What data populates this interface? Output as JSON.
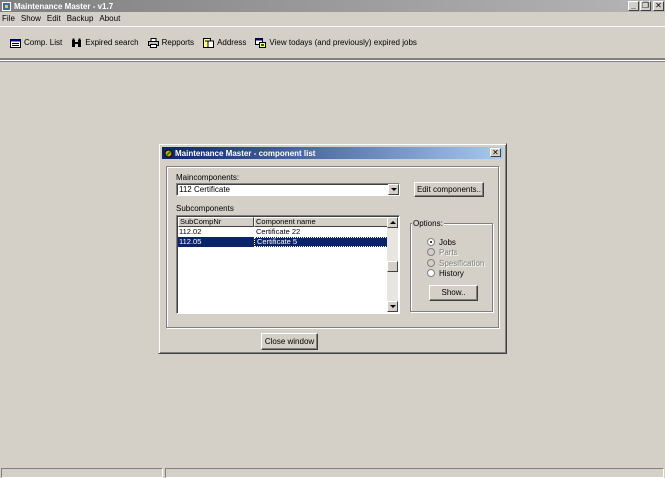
{
  "app": {
    "title": "Maintenance Master - v1.7",
    "window_buttons": {
      "minimize": "_",
      "restore": "❐",
      "close": "✕"
    }
  },
  "menu": [
    "File",
    "Show",
    "Edit",
    "Backup",
    "About"
  ],
  "toolbar": {
    "items": [
      {
        "label": "Comp. List",
        "icon": "list-icon"
      },
      {
        "label": "Expired search",
        "icon": "binoculars-icon"
      },
      {
        "label": "Repports",
        "icon": "printer-icon"
      },
      {
        "label": "Address",
        "icon": "address-icon"
      },
      {
        "label": "View todays (and previously) expired jobs",
        "icon": "calendar-icon"
      }
    ]
  },
  "dialog": {
    "title": "Maintenance Master -  component list",
    "close_glyph": "✕",
    "maincomponents_label": "Maincomponents:",
    "maincomponent_selected": "112 Certificate",
    "edit_button": "Edit components..",
    "subcomponents_label": "Subcomponents",
    "columns": [
      "SubCompNr",
      "Component name"
    ],
    "rows": [
      {
        "nr": "112.02",
        "name": "Certificate 22",
        "selected": false
      },
      {
        "nr": "112.05",
        "name": "Certificate 5",
        "selected": true
      }
    ],
    "options": {
      "legend": "Options:",
      "radios": [
        {
          "label": "Jobs",
          "checked": true,
          "enabled": true
        },
        {
          "label": "Parts",
          "checked": false,
          "enabled": false
        },
        {
          "label": "Spesification",
          "checked": false,
          "enabled": false
        },
        {
          "label": "History",
          "checked": false,
          "enabled": true
        }
      ],
      "show_button": "Show.."
    },
    "close_window_button": "Close window"
  },
  "colors": {
    "face": "#d4d0c8",
    "dialog_title": "#0a246a",
    "selection": "#0a246a"
  }
}
